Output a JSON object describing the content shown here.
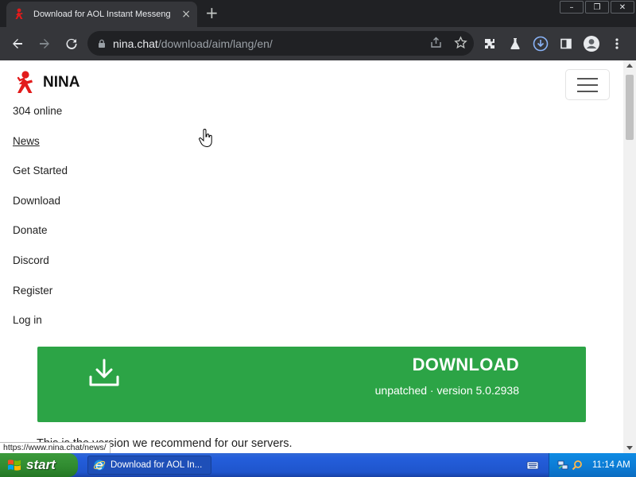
{
  "browser": {
    "tab_title": "Download for AOL Instant Messeng",
    "tab_close": "×",
    "new_tab": "+",
    "url_host": "nina.chat",
    "url_path": "/download/aim/lang/en/",
    "window_controls": [
      "–",
      "❐",
      "✕"
    ]
  },
  "site": {
    "brand_name": "NINA",
    "nav": {
      "online": "304 online",
      "news": "News",
      "get_started": "Get Started",
      "download": "Download",
      "donate": "Donate",
      "discord": "Discord",
      "register": "Register",
      "login": "Log in"
    },
    "download_banner": {
      "title": "DOWNLOAD",
      "subtitle": "unpatched · version 5.0.2938"
    },
    "recommend_text": "This is the version we recommend for our servers."
  },
  "status_bar": {
    "link_url": "https://www.nina.chat/news/"
  },
  "taskbar": {
    "start_label": "start",
    "task_label": "Download for AOL In...",
    "clock": "11:14 AM"
  },
  "colors": {
    "download_green": "#2ca446",
    "brand_red": "#e21b1b",
    "chrome_dark": "#202124",
    "chrome_toolbar": "#35363a",
    "download_icon_blue": "#1a73e8"
  },
  "icons": [
    "aim-running-man-icon",
    "lock-icon",
    "share-icon",
    "star-icon",
    "extensions-icon",
    "labs-flask-icon",
    "download-status-icon",
    "side-panel-icon",
    "profile-icon",
    "more-menu-icon",
    "hamburger-icon",
    "download-arrow-icon",
    "windows-flag-icon",
    "ie-icon",
    "keyboard-icon",
    "network-icon",
    "search-tray-icon"
  ]
}
